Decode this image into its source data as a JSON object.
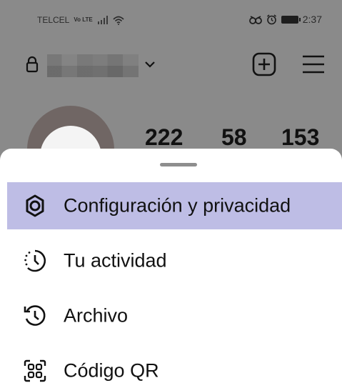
{
  "status_bar": {
    "carrier": "TELCEL",
    "network_badge": "Vo LTE",
    "time": "2:37",
    "icons": [
      "signal-icon",
      "wifi-icon",
      "eye-icon",
      "alarm-icon",
      "battery-icon"
    ]
  },
  "profile": {
    "username_obscured": true,
    "stats": [
      "222",
      "58",
      "153"
    ],
    "icons": [
      "lock-icon",
      "chevron-down-icon",
      "add-post-icon",
      "hamburger-menu-icon"
    ]
  },
  "sheet": {
    "items": [
      {
        "label": "Configuración y privacidad",
        "icon": "settings-gear-icon",
        "selected": true
      },
      {
        "label": "Tu actividad",
        "icon": "activity-clock-icon",
        "selected": false
      },
      {
        "label": "Archivo",
        "icon": "archive-history-icon",
        "selected": false
      },
      {
        "label": "Código QR",
        "icon": "qr-code-icon",
        "selected": false
      }
    ]
  },
  "colors": {
    "backdrop": "#8a8a8a",
    "sheet_background": "#ffffff",
    "selected_row": "#bebde5",
    "text": "#111111"
  }
}
